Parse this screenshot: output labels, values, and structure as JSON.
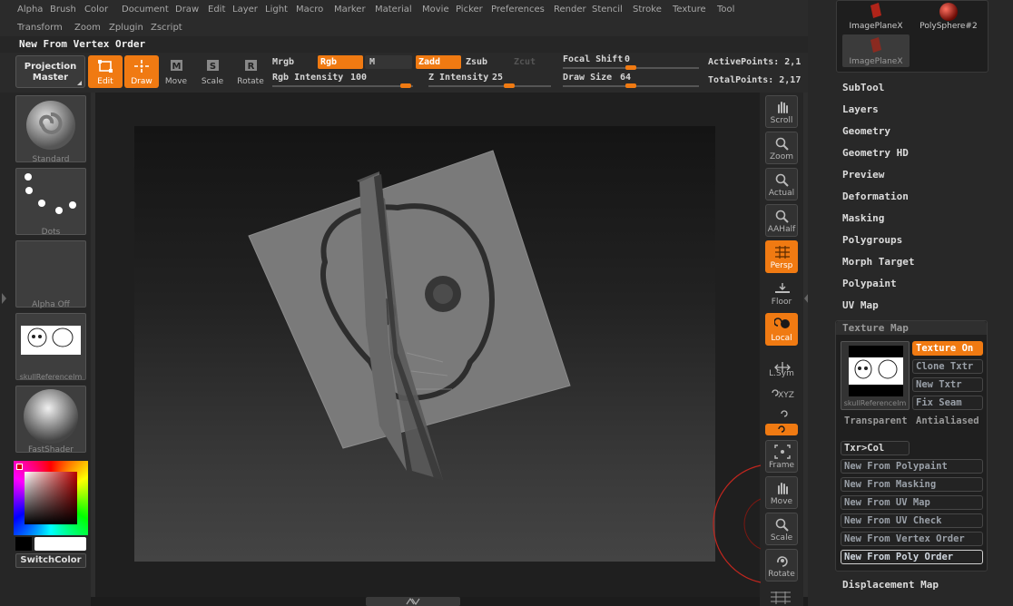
{
  "menu": [
    "Alpha",
    "Brush",
    "Color",
    "Document",
    "Draw",
    "Edit",
    "Layer",
    "Light",
    "Macro",
    "Marker",
    "Material",
    "Movie",
    "Picker",
    "Preferences",
    "Render",
    "Stencil",
    "Stroke",
    "Texture",
    "Tool"
  ],
  "menu2": [
    "Transform",
    "Zoom",
    "Zplugin",
    "Zscript"
  ],
  "current_action": "New From Vertex Order",
  "toolbar": {
    "projection_master": "Projection\nMaster",
    "edit": "Edit",
    "draw": "Draw",
    "move": "Move",
    "scale": "Scale",
    "rotate": "Rotate",
    "mrgb": "Mrgb",
    "rgb": "Rgb",
    "m": "M",
    "zadd": "Zadd",
    "zsub": "Zsub",
    "zcut": "Zcut",
    "rgb_intensity_label": "Rgb Intensity",
    "rgb_intensity": "100",
    "z_intensity_label": "Z Intensity",
    "z_intensity": "25",
    "focal_shift_label": "Focal Shift",
    "focal_shift": "0",
    "draw_size_label": "Draw Size",
    "draw_size": "64",
    "active_points": "ActivePoints: 2,1",
    "total_points": "TotalPoints: 2,17"
  },
  "left_shelf": {
    "brush": "Standard",
    "stroke": "Dots",
    "alpha": "Alpha  Off",
    "texture": "skullReferenceIm",
    "material": "FastShader",
    "switch_color": "SwitchColor"
  },
  "right_shelf": [
    "Scroll",
    "Zoom",
    "Actual",
    "AAHalf",
    "Persp",
    "Floor",
    "Local",
    "L.Sym",
    "XYZ",
    "Frame",
    "Move",
    "Scale",
    "Rotate"
  ],
  "subtools": {
    "item1": "ImagePlaneX",
    "item2": "PolySphere#2",
    "item3": "ImagePlaneX"
  },
  "palette": {
    "subtool": "SubTool",
    "layers": "Layers",
    "geometry": "Geometry",
    "geometry_hd": "Geometry HD",
    "preview": "Preview",
    "deformation": "Deformation",
    "masking": "Masking",
    "polygroups": "Polygroups",
    "morph_target": "Morph Target",
    "polypaint": "Polypaint",
    "uv_map": "UV Map",
    "texture_map": "Texture Map",
    "displacement_map": "Displacement Map"
  },
  "texture_map": {
    "texture_on": "Texture On",
    "clone_txtr": "Clone Txtr",
    "new_txtr": "New Txtr",
    "fix_seam": "Fix Seam",
    "thumb_label": "skullReferenceIm",
    "transparent": "Transparent",
    "antialiased": "Antialiased",
    "txr_col": "Txr>Col",
    "from_polypaint": "New From Polypaint",
    "from_masking": "New From Masking",
    "from_uv_map": "New From UV Map",
    "from_uv_check": "New From UV Check",
    "from_vertex_order": "New From Vertex Order",
    "from_poly_order": "New From Poly Order"
  },
  "colors": {
    "accent": "#f07a12",
    "bg": "#1c1c1c",
    "panel": "#282828"
  }
}
